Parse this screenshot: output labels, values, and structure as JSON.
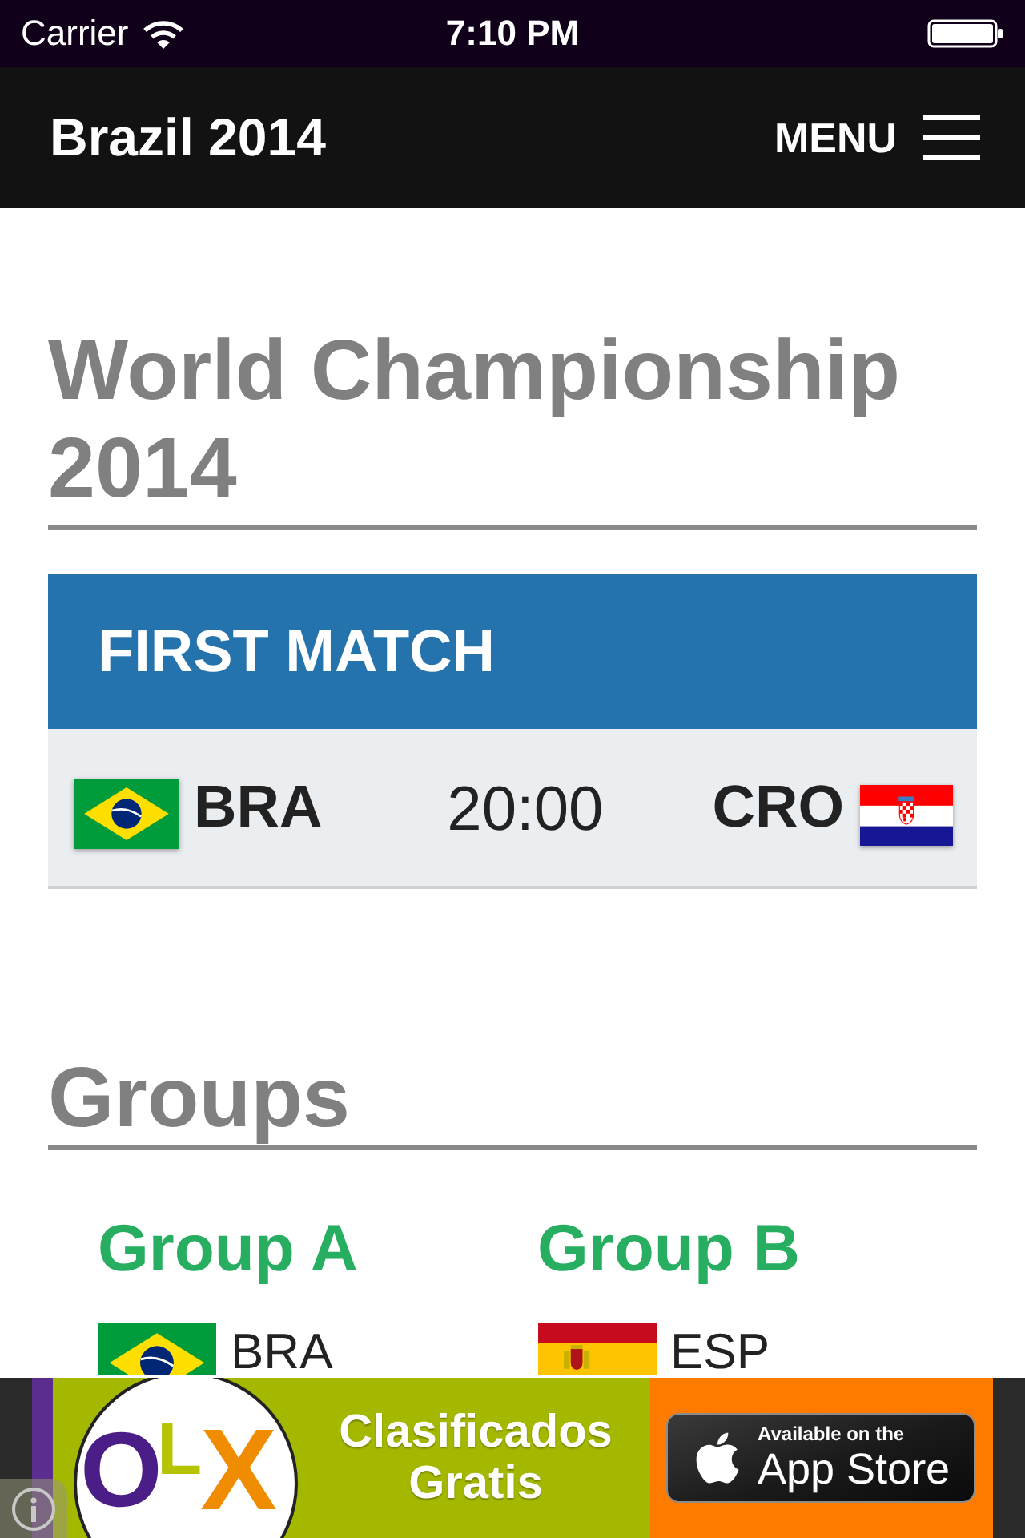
{
  "status_bar": {
    "carrier": "Carrier",
    "time": "7:10 PM"
  },
  "nav": {
    "title": "Brazil 2014",
    "menu": "MENU"
  },
  "page_title": "World Championship 2014",
  "first_match": {
    "heading": "FIRST MATCH",
    "home": {
      "code": "BRA",
      "kind": "brazil"
    },
    "time": "20:00",
    "away": {
      "code": "CRO",
      "kind": "croatia"
    }
  },
  "groups_heading": "Groups",
  "groups": [
    {
      "name": "Group A",
      "teams": [
        {
          "code": "BRA",
          "kind": "brazil"
        }
      ]
    },
    {
      "name": "Group B",
      "teams": [
        {
          "code": "ESP",
          "kind": "spain"
        }
      ]
    }
  ],
  "ad": {
    "logo": "OLX",
    "tagline": "Clasificados Gratis",
    "store_badge": {
      "caption": "Available on the",
      "title": "App Store"
    }
  }
}
